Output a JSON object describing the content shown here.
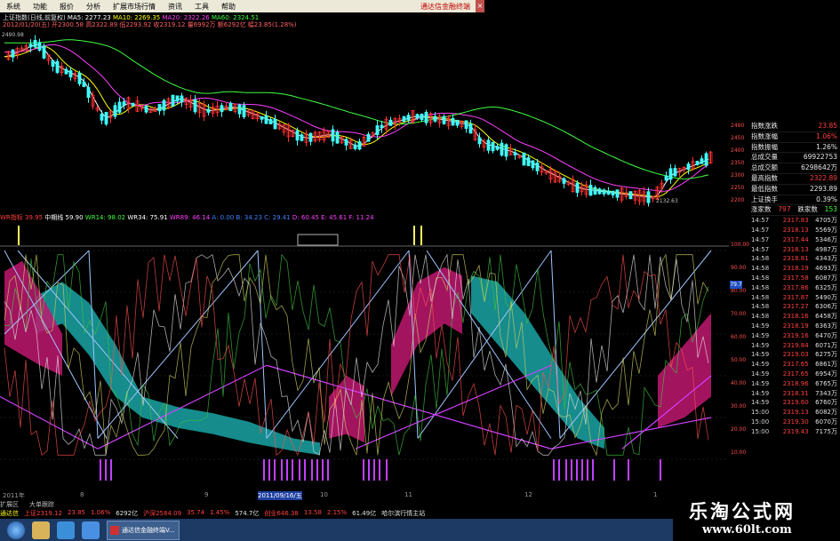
{
  "menubar": {
    "items": [
      "系统",
      "功能",
      "报价",
      "分析",
      "扩展市场行情",
      "资讯",
      "工具",
      "帮助"
    ],
    "right_label": "通达信金融终端"
  },
  "upper": {
    "title_line": "上证指数(日线,前复权)",
    "ma_items": [
      {
        "text": "MA5: 2277.23",
        "color": "#ffffff"
      },
      {
        "text": "MA10: 2269.35",
        "color": "#ffff00"
      },
      {
        "text": "MA20: 2322.26",
        "color": "#ff40ff"
      },
      {
        "text": "MA60: 2324.51",
        "color": "#40ff40"
      }
    ],
    "info_line": "2012/01/20(五) 开2300.58 高2322.89 低2293.92 收2319.12 量6992万 额6292亿 幅23.85(1.28%)",
    "date_label": "20120120",
    "high_label": "2490.98",
    "low_label": "2132.63",
    "price_axis": [
      "2490",
      "2450",
      "2400",
      "2350",
      "2300",
      "2250",
      "2200"
    ]
  },
  "side_panel": {
    "rows": [
      {
        "k": "指数涨跌",
        "v": "23.85",
        "red": true
      },
      {
        "k": "指数涨幅",
        "v": "1.06%",
        "red": true
      },
      {
        "k": "指数振幅",
        "v": "1.26%",
        "red": false
      },
      {
        "k": "总成交量",
        "v": "69922753",
        "red": false
      },
      {
        "k": "总成交额",
        "v": "6298642万",
        "red": false
      },
      {
        "k": "最高指数",
        "v": "2322.89",
        "red": true
      },
      {
        "k": "最低指数",
        "v": "2293.89",
        "red": false
      },
      {
        "k": "上证换手",
        "v": "0.39%",
        "red": false
      }
    ],
    "adv_label": "涨家数",
    "adv_value": "797",
    "dec_label": "跌家数",
    "dec_value": "153",
    "ticks": [
      [
        "14:57",
        "2317.83",
        "4705万"
      ],
      [
        "14:57",
        "2318.13",
        "5569万"
      ],
      [
        "14:57",
        "2317.44",
        "5346万"
      ],
      [
        "14:57",
        "2318.13",
        "4987万"
      ],
      [
        "14:58",
        "2318.81",
        "4343万"
      ],
      [
        "14:58",
        "2318.19",
        "4693万"
      ],
      [
        "14:58",
        "2317.58",
        "6087万"
      ],
      [
        "14:58",
        "2317.86",
        "6325万"
      ],
      [
        "14:58",
        "2317.87",
        "5490万"
      ],
      [
        "14:58",
        "2317.27",
        "6306万"
      ],
      [
        "14:58",
        "2318.16",
        "6458万"
      ],
      [
        "14:59",
        "2318.19",
        "6363万"
      ],
      [
        "14:59",
        "2319.16",
        "6470万"
      ],
      [
        "14:59",
        "2319.84",
        "6071万"
      ],
      [
        "14:59",
        "2319.03",
        "6275万"
      ],
      [
        "14:59",
        "2317.65",
        "6861万"
      ],
      [
        "14:59",
        "2317.65",
        "6954万"
      ],
      [
        "14:59",
        "2318.96",
        "6765万"
      ],
      [
        "14:59",
        "2318.31",
        "7343万"
      ],
      [
        "14:59",
        "2319.60",
        "6760万"
      ],
      [
        "15:00",
        "2319.13",
        "6082万"
      ],
      [
        "15:00",
        "2319.30",
        "6070万"
      ],
      [
        "15:00",
        "2319.43",
        "7175万"
      ]
    ]
  },
  "indicator": {
    "name": "WR",
    "items": [
      {
        "text": "WR指标 39.95",
        "color": "#ff4040"
      },
      {
        "text": "中期线 59.90",
        "color": "#ffffff"
      },
      {
        "text": "WR14: 98.02",
        "color": "#40ff40"
      },
      {
        "text": "WR34: 75.91",
        "color": "#ffffff"
      },
      {
        "text": "WR89: 46.14",
        "color": "#ff40ff"
      },
      {
        "text": "A: 0.00",
        "color": "#4080ff"
      },
      {
        "text": "B: 34.23",
        "color": "#4080ff"
      },
      {
        "text": "C: 29.41",
        "color": "#4080ff"
      },
      {
        "text": "D: 60.45",
        "color": "#ff40ff"
      },
      {
        "text": "E: 45.61",
        "color": "#ff40ff"
      },
      {
        "text": "F: 11.24",
        "color": "#ff40ff"
      }
    ],
    "right_axis": [
      "100.00",
      "90.00",
      "80.00",
      "70.00",
      "60.00",
      "50.00",
      "40.00",
      "30.00",
      "20.00",
      "10.00"
    ],
    "hover_value": "79.7"
  },
  "time_axis": {
    "items": [
      "2011年",
      "8",
      "9",
      "2011/09/16/五",
      "10",
      "11",
      "12",
      "1"
    ]
  },
  "status_tabs": [
    "扩展区",
    "大单跟踪"
  ],
  "quote_bar": [
    {
      "text": "通达信",
      "color": "#ffff00"
    },
    {
      "text": "上证2319.12",
      "color": "#ff4040"
    },
    {
      "text": "23.85",
      "color": "#ff4040"
    },
    {
      "text": "1.06%",
      "color": "#ff4040"
    },
    {
      "text": "6292亿",
      "color": "#e0e0e0"
    },
    {
      "text": "沪深2584.09",
      "color": "#ff4040"
    },
    {
      "text": "35.74",
      "color": "#ff4040"
    },
    {
      "text": "1.45%",
      "color": "#ff4040"
    },
    {
      "text": "574.7亿",
      "color": "#e0e0e0"
    },
    {
      "text": "创业646.38",
      "color": "#ff4040"
    },
    {
      "text": "13.58",
      "color": "#ff4040"
    },
    {
      "text": "2.15%",
      "color": "#ff4040"
    },
    {
      "text": "61.49亿",
      "color": "#e0e0e0"
    },
    {
      "text": "哈尔滨行情主站",
      "color": "#e0e0e0"
    }
  ],
  "taskbar": {
    "window_label": "通达信金融终端V..."
  },
  "brand": {
    "cn": "乐淘公式网",
    "url": "www.60lt.com"
  }
}
